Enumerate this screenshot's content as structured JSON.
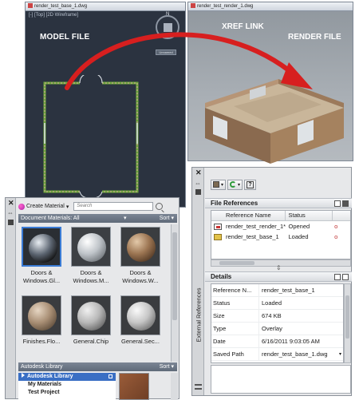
{
  "model_window": {
    "title": "render_test_base_1.dwg",
    "viewport_label": "[-] [Top] [2D Wireframe]",
    "heading": "MODEL FILE",
    "compass_n": "N",
    "wcs": "Unnamed"
  },
  "render_window": {
    "title": "render_test_render_1.dwg",
    "xref_link": "XREF LINK",
    "heading": "RENDER FILE"
  },
  "materials": {
    "create_material": "Create Material",
    "search_placeholder": "Search",
    "document_materials": "Document Materials: All",
    "sort": "Sort",
    "items": [
      {
        "line1": "Doors &",
        "line2": "Windows.Gl..."
      },
      {
        "line1": "Doors &",
        "line2": "Windows.M..."
      },
      {
        "line1": "Doors &",
        "line2": "Windows.W..."
      },
      {
        "line1": "Finishes.Flo...",
        "line2": ""
      },
      {
        "line1": "General.Chip",
        "line2": ""
      },
      {
        "line1": "General.Sec...",
        "line2": ""
      }
    ],
    "library_bar": "Autodesk Library",
    "library_sort": "Sort",
    "library_items": [
      "Autodesk Library",
      "My Materials",
      "Test Project"
    ]
  },
  "xref": {
    "palette_title": "External References",
    "file_references": {
      "title": "File References",
      "columns": [
        "Reference Name",
        "Status",
        ""
      ],
      "rows": [
        {
          "name": "render_test_render_1*",
          "status": "Opened",
          "extra": "o"
        },
        {
          "name": "render_test_base_1",
          "status": "Loaded",
          "extra": "o"
        }
      ]
    },
    "details": {
      "title": "Details",
      "rows": [
        {
          "k": "Reference N...",
          "v": "render_test_base_1"
        },
        {
          "k": "Status",
          "v": "Loaded"
        },
        {
          "k": "Size",
          "v": "674 KB"
        },
        {
          "k": "Type",
          "v": "Overlay"
        },
        {
          "k": "Date",
          "v": "6/16/2011 9:03:05 AM"
        },
        {
          "k": "Saved Path",
          "v": "render_test_base_1.dwg"
        }
      ]
    }
  },
  "colors": {
    "arrow": "#d71f1f",
    "wall_green": "#6ea83d",
    "selection": "#3a6fc4"
  }
}
